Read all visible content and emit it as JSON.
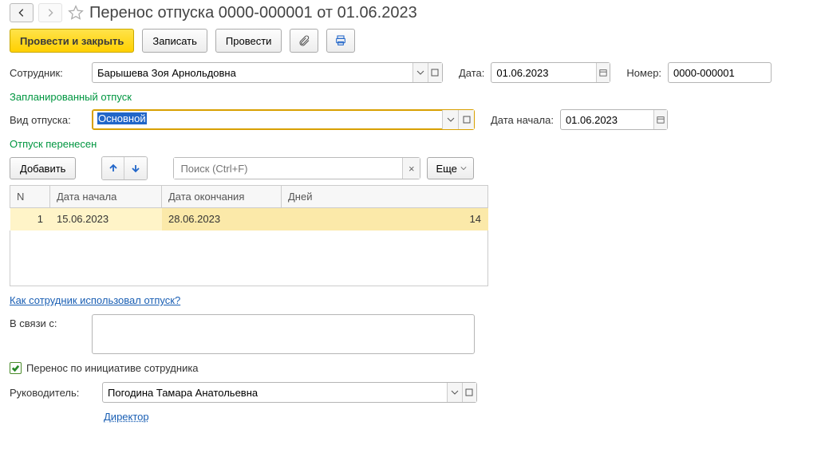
{
  "header": {
    "title": "Перенос отпуска 0000-000001 от 01.06.2023"
  },
  "toolbar": {
    "submit_close": "Провести и закрыть",
    "save": "Записать",
    "submit": "Провести"
  },
  "fields": {
    "employee_label": "Сотрудник:",
    "employee_value": "Барышева Зоя Арнольдовна",
    "date_label": "Дата:",
    "date_value": "01.06.2023",
    "number_label": "Номер:",
    "number_value": "0000-000001"
  },
  "planned": {
    "section": "Запланированный отпуск",
    "type_label": "Вид отпуска:",
    "type_value": "Основной",
    "start_label": "Дата начала:",
    "start_value": "01.06.2023"
  },
  "rescheduled": {
    "section": "Отпуск перенесен",
    "add": "Добавить",
    "search_placeholder": "Поиск (Ctrl+F)",
    "more": "Еще",
    "columns": {
      "n": "N",
      "start": "Дата начала",
      "end": "Дата окончания",
      "days": "Дней"
    },
    "rows": [
      {
        "n": "1",
        "start": "15.06.2023",
        "end": "28.06.2023",
        "days": "14"
      }
    ]
  },
  "links": {
    "usage": "Как сотрудник использовал отпуск?"
  },
  "reason": {
    "label": "В связи с:",
    "value": ""
  },
  "checkbox": {
    "label": "Перенос по инициативе сотрудника",
    "checked": true
  },
  "manager": {
    "label": "Руководитель:",
    "value": "Погодина Тамара Анатольевна",
    "position": "Директор"
  }
}
